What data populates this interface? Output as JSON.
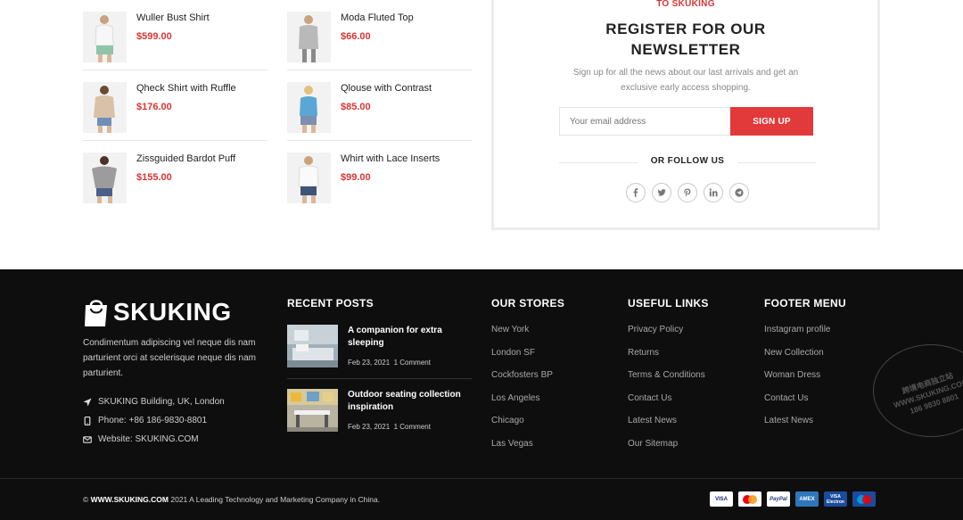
{
  "products": {
    "col1": [
      {
        "name": "Wuller Bust Shirt",
        "price": "$599.00"
      },
      {
        "name": "Qheck Shirt with Ruffle",
        "price": "$176.00"
      },
      {
        "name": "Zissguided Bardot Puff",
        "price": "$155.00"
      }
    ],
    "col2": [
      {
        "name": "Moda Fluted Top",
        "price": "$66.00"
      },
      {
        "name": "Qlouse with Contrast",
        "price": "$85.00"
      },
      {
        "name": "Whirt with Lace Inserts",
        "price": "$99.00"
      }
    ]
  },
  "newsletter": {
    "kicker": "TO SKUKING",
    "title_line1": "REGISTER FOR OUR",
    "title_line2": "NEWSLETTER",
    "description": "Sign up for all the news about our last arrivals and get an exclusive early access shopping.",
    "email_placeholder": "Your email address",
    "signup_label": "SIGN UP",
    "follow_label": "OR FOLLOW US",
    "socials": [
      "facebook-icon",
      "twitter-icon",
      "pinterest-icon",
      "linkedin-icon",
      "telegram-icon"
    ],
    "accent_color": "#e2393b"
  },
  "footer": {
    "brand": "SKUKING",
    "about": "Condimentum adipiscing vel neque dis nam parturient orci at scelerisque neque dis nam parturient.",
    "address": "SKUKING Building, UK, London",
    "phone": "Phone: +86 186-9830-8801",
    "website": "Website: SKUKING.COM",
    "recent_posts": {
      "heading": "RECENT POSTS",
      "items": [
        {
          "title": "A companion for extra sleeping",
          "date": "Feb 23, 2021",
          "comments": "1 Comment"
        },
        {
          "title": "Outdoor seating collection inspiration",
          "date": "Feb 23, 2021",
          "comments": "1 Comment"
        }
      ]
    },
    "stores": {
      "heading": "OUR STORES",
      "items": [
        "New York",
        "London SF",
        "Cockfosters BP",
        "Los Angeles",
        "Chicago",
        "Las Vegas"
      ]
    },
    "useful_links": {
      "heading": "USEFUL LINKS",
      "items": [
        "Privacy Policy",
        "Returns",
        "Terms & Conditions",
        "Contact Us",
        "Latest News",
        "Our Sitemap"
      ]
    },
    "footer_menu": {
      "heading": "FOOTER MENU",
      "items": [
        "Instagram profile",
        "New Collection",
        "Woman Dress",
        "Contact Us",
        "Latest News"
      ]
    },
    "copyright_domain": "WWW.SKUKING.COM",
    "copyright_rest": "2021 A Leading Technology and Marketing Company in China.",
    "payments": [
      "VISA",
      "MC",
      "PayPal",
      "AMEX",
      "VISA Electron",
      "Maestro"
    ],
    "watermark_line1": "跨境电商独立站",
    "watermark_line2": "WWW.SKUKING.COM",
    "watermark_line3": "186 9830 8801"
  }
}
